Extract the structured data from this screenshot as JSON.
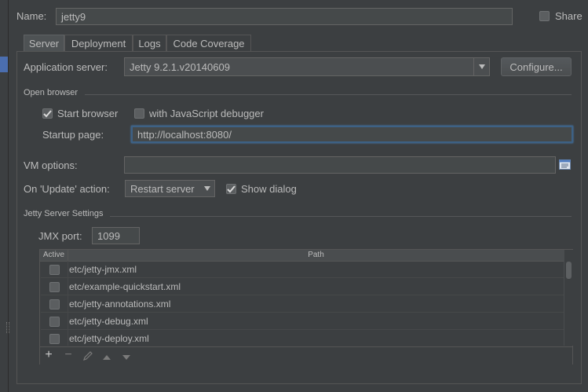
{
  "name": {
    "label": "Name:",
    "value": "jetty9"
  },
  "share": {
    "label": "Share",
    "checked": false
  },
  "tabs": [
    {
      "label": "Server",
      "active": true
    },
    {
      "label": "Deployment",
      "active": false
    },
    {
      "label": "Logs",
      "active": false
    },
    {
      "label": "Code Coverage",
      "active": false
    }
  ],
  "app_server": {
    "label": "Application server:",
    "value": "Jetty 9.2.1.v20140609",
    "configure_label": "Configure..."
  },
  "open_browser": {
    "section_label": "Open browser",
    "start_browser_label": "Start browser",
    "start_browser_checked": true,
    "js_debugger_label": "with JavaScript debugger",
    "js_debugger_checked": false,
    "startup_page_label": "Startup page:",
    "startup_page_value": "http://localhost:8080/"
  },
  "vm_options": {
    "label": "VM options:",
    "value": ""
  },
  "on_update": {
    "label": "On 'Update' action:",
    "value": "Restart server",
    "show_dialog_label": "Show dialog",
    "show_dialog_checked": true
  },
  "jetty_settings": {
    "section_label": "Jetty Server Settings",
    "jmx_label": "JMX port:",
    "jmx_value": "1099",
    "columns": {
      "active": "Active",
      "path": "Path"
    },
    "rows": [
      {
        "path": "etc/jetty-jmx.xml",
        "active": false
      },
      {
        "path": "etc/example-quickstart.xml",
        "active": false
      },
      {
        "path": "etc/jetty-annotations.xml",
        "active": false
      },
      {
        "path": "etc/jetty-debug.xml",
        "active": false
      },
      {
        "path": "etc/jetty-deploy.xml",
        "active": false
      }
    ],
    "toolbar": {
      "add": "+",
      "remove": "−"
    }
  }
}
